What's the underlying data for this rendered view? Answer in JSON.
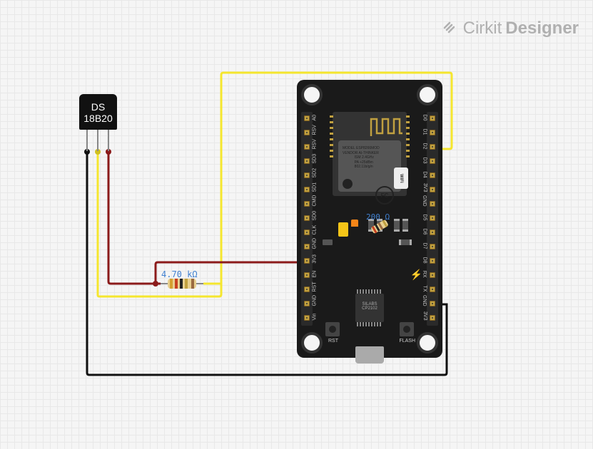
{
  "watermark": {
    "brand_prefix": "Cirkit",
    "brand_suffix": "Designer"
  },
  "sensor": {
    "line1": "DS",
    "line2": "18B20"
  },
  "board": {
    "left_pins": [
      "A0",
      "RSV",
      "RSV",
      "SD3",
      "SD2",
      "SD1",
      "CMD",
      "SD0",
      "CLK",
      "GND",
      "3V3",
      "EN",
      "RST",
      "GND",
      "Vin"
    ],
    "right_pins": [
      "D0",
      "D1",
      "D2",
      "D3",
      "D4",
      "3V3",
      "GND",
      "D5",
      "D6",
      "D7",
      "D8",
      "RX",
      "TX",
      "GND",
      "3V3"
    ],
    "rst_label": "RST",
    "flash_label": "FLASH",
    "usb_chip_l1": "SILABS",
    "usb_chip_l2": "CP2102",
    "shield_l1": "MODEL",
    "shield_l2": "VENDOR",
    "shield_l3": "ESP8266MOD",
    "shield_l4": "AI-THINKER",
    "shield_l5": "ISM 2.4GHz",
    "shield_l6": "PA +25dBm",
    "shield_l7": "802.11b/g/n",
    "fcc": "FC",
    "wifi": "WiFi"
  },
  "resistor_ext": {
    "label": "4.70 kΩ"
  },
  "resistor_int": {
    "label": "200 Ω"
  },
  "wires": [
    {
      "name": "gnd",
      "color": "black",
      "from": "DS18B20.GND",
      "to": "NodeMCU.GND"
    },
    {
      "name": "data",
      "color": "yellow",
      "from": "DS18B20.DQ",
      "to": "NodeMCU.D2"
    },
    {
      "name": "vcc",
      "color": "darkred",
      "from": "DS18B20.VDD",
      "to": "NodeMCU.3V3"
    },
    {
      "name": "pullup",
      "color": "darkred/yellow",
      "from": "DQ",
      "to": "3V3",
      "via": "4.70 kΩ resistor"
    }
  ]
}
